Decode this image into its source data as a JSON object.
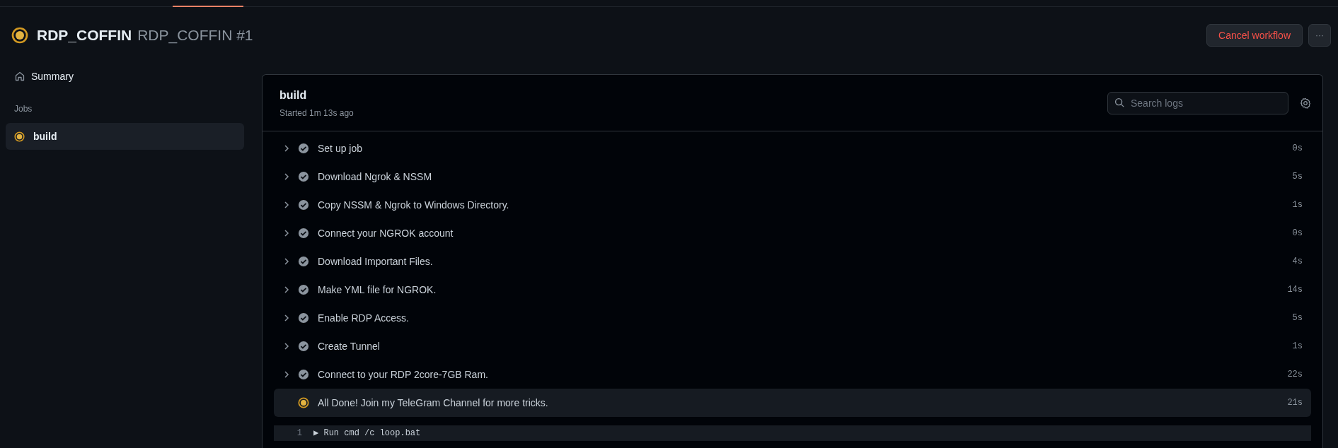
{
  "run": {
    "kind": "in_progress",
    "workflow": "RDP_COFFIN",
    "title": "RDP_COFFIN #1"
  },
  "actions": {
    "cancel": "Cancel workflow",
    "more": "···"
  },
  "sidebar": {
    "summary": "Summary",
    "jobs_heading": "Jobs",
    "jobs": [
      {
        "name": "build",
        "kind": "in_progress",
        "selected": true
      }
    ]
  },
  "job": {
    "name": "build",
    "started": "Started 1m 13s ago",
    "search": {
      "placeholder": "Search logs"
    },
    "steps": [
      {
        "name": "Set up job",
        "kind": "success",
        "duration": "0s",
        "expanded": false
      },
      {
        "name": "Download Ngrok & NSSM",
        "kind": "success",
        "duration": "5s",
        "expanded": false
      },
      {
        "name": "Copy NSSM & Ngrok to Windows Directory.",
        "kind": "success",
        "duration": "1s",
        "expanded": false
      },
      {
        "name": "Connect your NGROK account",
        "kind": "success",
        "duration": "0s",
        "expanded": false
      },
      {
        "name": "Download Important Files.",
        "kind": "success",
        "duration": "4s",
        "expanded": false
      },
      {
        "name": "Make YML file for NGROK.",
        "kind": "success",
        "duration": "14s",
        "expanded": false
      },
      {
        "name": "Enable RDP Access.",
        "kind": "success",
        "duration": "5s",
        "expanded": false
      },
      {
        "name": "Create Tunnel",
        "kind": "success",
        "duration": "1s",
        "expanded": false
      },
      {
        "name": "Connect to your RDP 2core-7GB Ram.",
        "kind": "success",
        "duration": "22s",
        "expanded": false
      },
      {
        "name": "All Done! Join my TeleGram Channel for more tricks.",
        "kind": "in_progress",
        "duration": "21s",
        "expanded": true,
        "log": [
          {
            "number": "1",
            "marker": "▶",
            "text": "Run cmd /c loop.bat"
          }
        ]
      }
    ]
  }
}
